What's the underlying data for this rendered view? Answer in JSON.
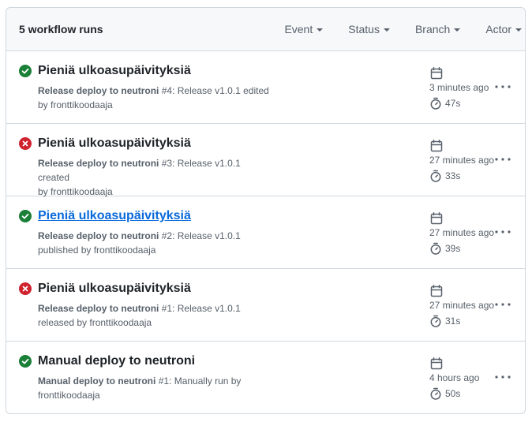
{
  "header": {
    "title": "5 workflow runs",
    "filters": [
      "Event",
      "Status",
      "Branch",
      "Actor"
    ]
  },
  "runs": [
    {
      "status": "success",
      "title": "Pieniä ulkoasupäivityksiä",
      "workflow": "Release deploy to neutroni",
      "number": "#4",
      "event_text": ": Release v1.0.1 edited",
      "line2": "by fronttikoodaaja",
      "time": "3 minutes ago",
      "duration": "47s"
    },
    {
      "status": "failure",
      "title": "Pieniä ulkoasupäivityksiä",
      "workflow": "Release deploy to neutroni",
      "number": "#3",
      "event_text": ": Release v1.0.1 created",
      "line2": "by fronttikoodaaja",
      "time": "27 minutes ago",
      "duration": "33s"
    },
    {
      "status": "success",
      "title": "Pieniä ulkoasupäivityksiä",
      "workflow": "Release deploy to neutroni",
      "number": "#2",
      "event_text": ": Release v1.0.1",
      "line2": "published by fronttikoodaaja",
      "time": "27 minutes ago",
      "duration": "39s"
    },
    {
      "status": "failure",
      "title": "Pieniä ulkoasupäivityksiä",
      "workflow": "Release deploy to neutroni",
      "number": "#1",
      "event_text": ": Release v1.0.1",
      "line2": "released by fronttikoodaaja",
      "time": "27 minutes ago",
      "duration": "31s"
    },
    {
      "status": "success",
      "title": "Manual deploy to neutroni",
      "workflow": "Manual deploy to neutroni",
      "number": "#1",
      "event_text": ": Manually run by",
      "line2": "fronttikoodaaja",
      "time": "4 hours ago",
      "duration": "50s"
    }
  ],
  "icons": {
    "success": "check-circle-fill-icon",
    "failure": "x-circle-fill-icon",
    "calendar": "calendar-icon",
    "stopwatch": "stopwatch-icon",
    "more": "kebab-horizontal-icon"
  },
  "colors": {
    "success": "#1a7f37",
    "failure": "#cf222e",
    "link": "#0969da",
    "muted": "#57606a",
    "border": "#d0d7de",
    "header_bg": "#f6f8fa"
  }
}
